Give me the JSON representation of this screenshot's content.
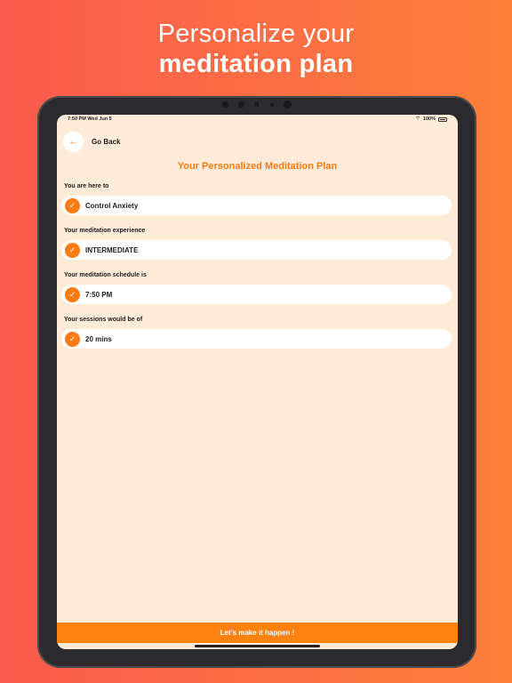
{
  "promo": {
    "headline_line1": "Personalize your",
    "headline_line2": "meditation plan"
  },
  "status_bar": {
    "time": "7:50 PM   Wed Jun 5",
    "battery": "100%"
  },
  "nav": {
    "back_label": "Go Back"
  },
  "plan": {
    "title": "Your Personalized Meditation Plan",
    "items": [
      {
        "label": "You are here to",
        "value": "Control Anxiety"
      },
      {
        "label": "Your meditation experience",
        "value": "INTERMEDIATE"
      },
      {
        "label": "Your meditation schedule is",
        "value": "7:50 PM"
      },
      {
        "label": "Your sessions would be of",
        "value": "20 mins"
      }
    ]
  },
  "cta": {
    "label": "Let’s make it happen !"
  },
  "colors": {
    "accent": "#ff7b13",
    "screen_bg": "#ffebd8",
    "background_gradient_start": "#fb5a4d",
    "background_gradient_end": "#fd803b"
  },
  "icons": {
    "back": "arrow-left-icon",
    "check": "checkmark-icon",
    "wifi": "wifi-icon",
    "battery": "battery-icon"
  }
}
